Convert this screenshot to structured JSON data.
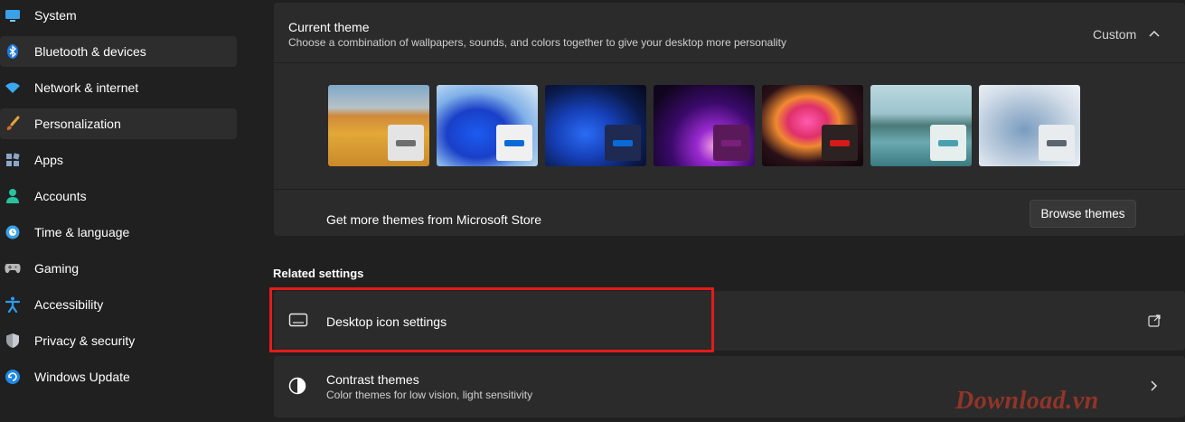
{
  "sidebar": {
    "items": [
      {
        "label": "System",
        "icon": "monitor-icon"
      },
      {
        "label": "Bluetooth & devices",
        "icon": "bluetooth-icon"
      },
      {
        "label": "Network & internet",
        "icon": "wifi-icon"
      },
      {
        "label": "Personalization",
        "icon": "brush-icon"
      },
      {
        "label": "Apps",
        "icon": "apps-icon"
      },
      {
        "label": "Accounts",
        "icon": "person-icon"
      },
      {
        "label": "Time & language",
        "icon": "globe-clock-icon"
      },
      {
        "label": "Gaming",
        "icon": "gamepad-icon"
      },
      {
        "label": "Accessibility",
        "icon": "accessibility-icon"
      },
      {
        "label": "Privacy & security",
        "icon": "shield-icon"
      },
      {
        "label": "Windows Update",
        "icon": "update-icon"
      }
    ]
  },
  "theme": {
    "title": "Current theme",
    "subtitle": "Choose a combination of wallpapers, sounds, and colors together to give your desktop more personality",
    "current_value": "Custom",
    "store_text": "Get more themes from Microsoft Store",
    "browse_label": "Browse themes",
    "thumbnails": [
      {
        "name": "desert",
        "accent": "#6e6e6e",
        "swatch_bg": "#e4e4e4"
      },
      {
        "name": "bloom-light",
        "accent": "#0a6bd6",
        "swatch_bg": "#f0f0f0"
      },
      {
        "name": "bloom-dark",
        "accent": "#0a6bd6",
        "swatch_bg": "#1e2a52"
      },
      {
        "name": "glow",
        "accent": "#7a1f7a",
        "swatch_bg": "#5a1a5a"
      },
      {
        "name": "captured-motion",
        "accent": "#d41a1a",
        "swatch_bg": "#2c2222"
      },
      {
        "name": "sunrise-lake",
        "accent": "#4aa0b0",
        "swatch_bg": "#e6eeee"
      },
      {
        "name": "flow",
        "accent": "#5a6570",
        "swatch_bg": "#e8ecef"
      }
    ]
  },
  "related": {
    "title": "Related settings",
    "desktop_icon": {
      "label": "Desktop icon settings"
    },
    "contrast": {
      "label": "Contrast themes",
      "sub": "Color themes for low vision, light sensitivity"
    }
  },
  "watermark": "Download.vn"
}
